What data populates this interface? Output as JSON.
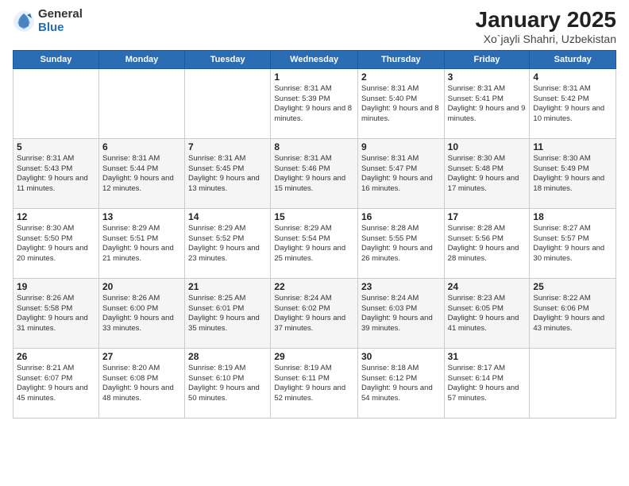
{
  "logo": {
    "general": "General",
    "blue": "Blue"
  },
  "title": "January 2025",
  "subtitle": "Xo`jayli Shahri, Uzbekistan",
  "days_of_week": [
    "Sunday",
    "Monday",
    "Tuesday",
    "Wednesday",
    "Thursday",
    "Friday",
    "Saturday"
  ],
  "weeks": [
    [
      {
        "day": "",
        "info": ""
      },
      {
        "day": "",
        "info": ""
      },
      {
        "day": "",
        "info": ""
      },
      {
        "day": "1",
        "info": "Sunrise: 8:31 AM\nSunset: 5:39 PM\nDaylight: 9 hours and 8 minutes."
      },
      {
        "day": "2",
        "info": "Sunrise: 8:31 AM\nSunset: 5:40 PM\nDaylight: 9 hours and 8 minutes."
      },
      {
        "day": "3",
        "info": "Sunrise: 8:31 AM\nSunset: 5:41 PM\nDaylight: 9 hours and 9 minutes."
      },
      {
        "day": "4",
        "info": "Sunrise: 8:31 AM\nSunset: 5:42 PM\nDaylight: 9 hours and 10 minutes."
      }
    ],
    [
      {
        "day": "5",
        "info": "Sunrise: 8:31 AM\nSunset: 5:43 PM\nDaylight: 9 hours and 11 minutes."
      },
      {
        "day": "6",
        "info": "Sunrise: 8:31 AM\nSunset: 5:44 PM\nDaylight: 9 hours and 12 minutes."
      },
      {
        "day": "7",
        "info": "Sunrise: 8:31 AM\nSunset: 5:45 PM\nDaylight: 9 hours and 13 minutes."
      },
      {
        "day": "8",
        "info": "Sunrise: 8:31 AM\nSunset: 5:46 PM\nDaylight: 9 hours and 15 minutes."
      },
      {
        "day": "9",
        "info": "Sunrise: 8:31 AM\nSunset: 5:47 PM\nDaylight: 9 hours and 16 minutes."
      },
      {
        "day": "10",
        "info": "Sunrise: 8:30 AM\nSunset: 5:48 PM\nDaylight: 9 hours and 17 minutes."
      },
      {
        "day": "11",
        "info": "Sunrise: 8:30 AM\nSunset: 5:49 PM\nDaylight: 9 hours and 18 minutes."
      }
    ],
    [
      {
        "day": "12",
        "info": "Sunrise: 8:30 AM\nSunset: 5:50 PM\nDaylight: 9 hours and 20 minutes."
      },
      {
        "day": "13",
        "info": "Sunrise: 8:29 AM\nSunset: 5:51 PM\nDaylight: 9 hours and 21 minutes."
      },
      {
        "day": "14",
        "info": "Sunrise: 8:29 AM\nSunset: 5:52 PM\nDaylight: 9 hours and 23 minutes."
      },
      {
        "day": "15",
        "info": "Sunrise: 8:29 AM\nSunset: 5:54 PM\nDaylight: 9 hours and 25 minutes."
      },
      {
        "day": "16",
        "info": "Sunrise: 8:28 AM\nSunset: 5:55 PM\nDaylight: 9 hours and 26 minutes."
      },
      {
        "day": "17",
        "info": "Sunrise: 8:28 AM\nSunset: 5:56 PM\nDaylight: 9 hours and 28 minutes."
      },
      {
        "day": "18",
        "info": "Sunrise: 8:27 AM\nSunset: 5:57 PM\nDaylight: 9 hours and 30 minutes."
      }
    ],
    [
      {
        "day": "19",
        "info": "Sunrise: 8:26 AM\nSunset: 5:58 PM\nDaylight: 9 hours and 31 minutes."
      },
      {
        "day": "20",
        "info": "Sunrise: 8:26 AM\nSunset: 6:00 PM\nDaylight: 9 hours and 33 minutes."
      },
      {
        "day": "21",
        "info": "Sunrise: 8:25 AM\nSunset: 6:01 PM\nDaylight: 9 hours and 35 minutes."
      },
      {
        "day": "22",
        "info": "Sunrise: 8:24 AM\nSunset: 6:02 PM\nDaylight: 9 hours and 37 minutes."
      },
      {
        "day": "23",
        "info": "Sunrise: 8:24 AM\nSunset: 6:03 PM\nDaylight: 9 hours and 39 minutes."
      },
      {
        "day": "24",
        "info": "Sunrise: 8:23 AM\nSunset: 6:05 PM\nDaylight: 9 hours and 41 minutes."
      },
      {
        "day": "25",
        "info": "Sunrise: 8:22 AM\nSunset: 6:06 PM\nDaylight: 9 hours and 43 minutes."
      }
    ],
    [
      {
        "day": "26",
        "info": "Sunrise: 8:21 AM\nSunset: 6:07 PM\nDaylight: 9 hours and 45 minutes."
      },
      {
        "day": "27",
        "info": "Sunrise: 8:20 AM\nSunset: 6:08 PM\nDaylight: 9 hours and 48 minutes."
      },
      {
        "day": "28",
        "info": "Sunrise: 8:19 AM\nSunset: 6:10 PM\nDaylight: 9 hours and 50 minutes."
      },
      {
        "day": "29",
        "info": "Sunrise: 8:19 AM\nSunset: 6:11 PM\nDaylight: 9 hours and 52 minutes."
      },
      {
        "day": "30",
        "info": "Sunrise: 8:18 AM\nSunset: 6:12 PM\nDaylight: 9 hours and 54 minutes."
      },
      {
        "day": "31",
        "info": "Sunrise: 8:17 AM\nSunset: 6:14 PM\nDaylight: 9 hours and 57 minutes."
      },
      {
        "day": "",
        "info": ""
      }
    ]
  ]
}
